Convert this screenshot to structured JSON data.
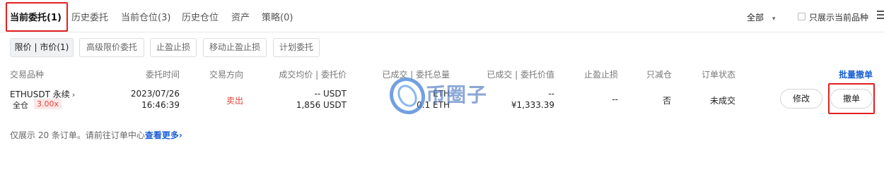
{
  "tabs": [
    {
      "label": "当前委托(1)",
      "active": true
    },
    {
      "label": "历史委托",
      "active": false
    },
    {
      "label": "当前仓位(3)",
      "active": false
    },
    {
      "label": "历史仓位",
      "active": false
    },
    {
      "label": "资产",
      "active": false
    },
    {
      "label": "策略(0)",
      "active": false
    }
  ],
  "filters": {
    "scope_label": "全部",
    "chevron_icon": "chevron-down-icon",
    "only_current_label": "只展示当前品种",
    "only_current_checked": false,
    "menu_icon": "menu-icon"
  },
  "subtabs": [
    {
      "label": "限价 | 市价(1)",
      "active": true
    },
    {
      "label": "高级限价委托",
      "active": false
    },
    {
      "label": "止盈止损",
      "active": false
    },
    {
      "label": "移动止盈止损",
      "active": false
    },
    {
      "label": "计划委托",
      "active": false
    }
  ],
  "table": {
    "headers": [
      "交易品种",
      "委托时间",
      "交易方向",
      "成交均价 | 委托价",
      "已成交 | 委托总量",
      "已成交 | 委托价值",
      "止盈止损",
      "只减仓",
      "订单状态"
    ],
    "batch_cancel_label": "批量撤单",
    "rows": [
      {
        "symbol": "ETHUSDT 永续",
        "symbol_arrow": "›",
        "margin_mode": "全仓",
        "leverage": "3.00x",
        "date": "2023/07/26",
        "time": "16:46:39",
        "direction": "卖出",
        "avg_price": "-- USDT",
        "order_price": "1,856 USDT",
        "filled_qty": "ETH",
        "total_qty": "0.1 ETH",
        "filled_value": "--",
        "order_value": "¥1,333.39",
        "tp_sl": "--",
        "reduce_only": "否",
        "status": "未成交",
        "modify_label": "修改",
        "cancel_label": "撤单"
      }
    ]
  },
  "footer": {
    "note": "仅展示 20 条订单。请前往订单中心",
    "link": "查看更多",
    "link_arrow": "›"
  },
  "watermark": {
    "text": "币圈子",
    "logo_icon": "watermark-logo-icon"
  },
  "colors": {
    "accent": "#1a5fd6",
    "sell": "#e0443c",
    "highlight_box": "#e02020"
  }
}
